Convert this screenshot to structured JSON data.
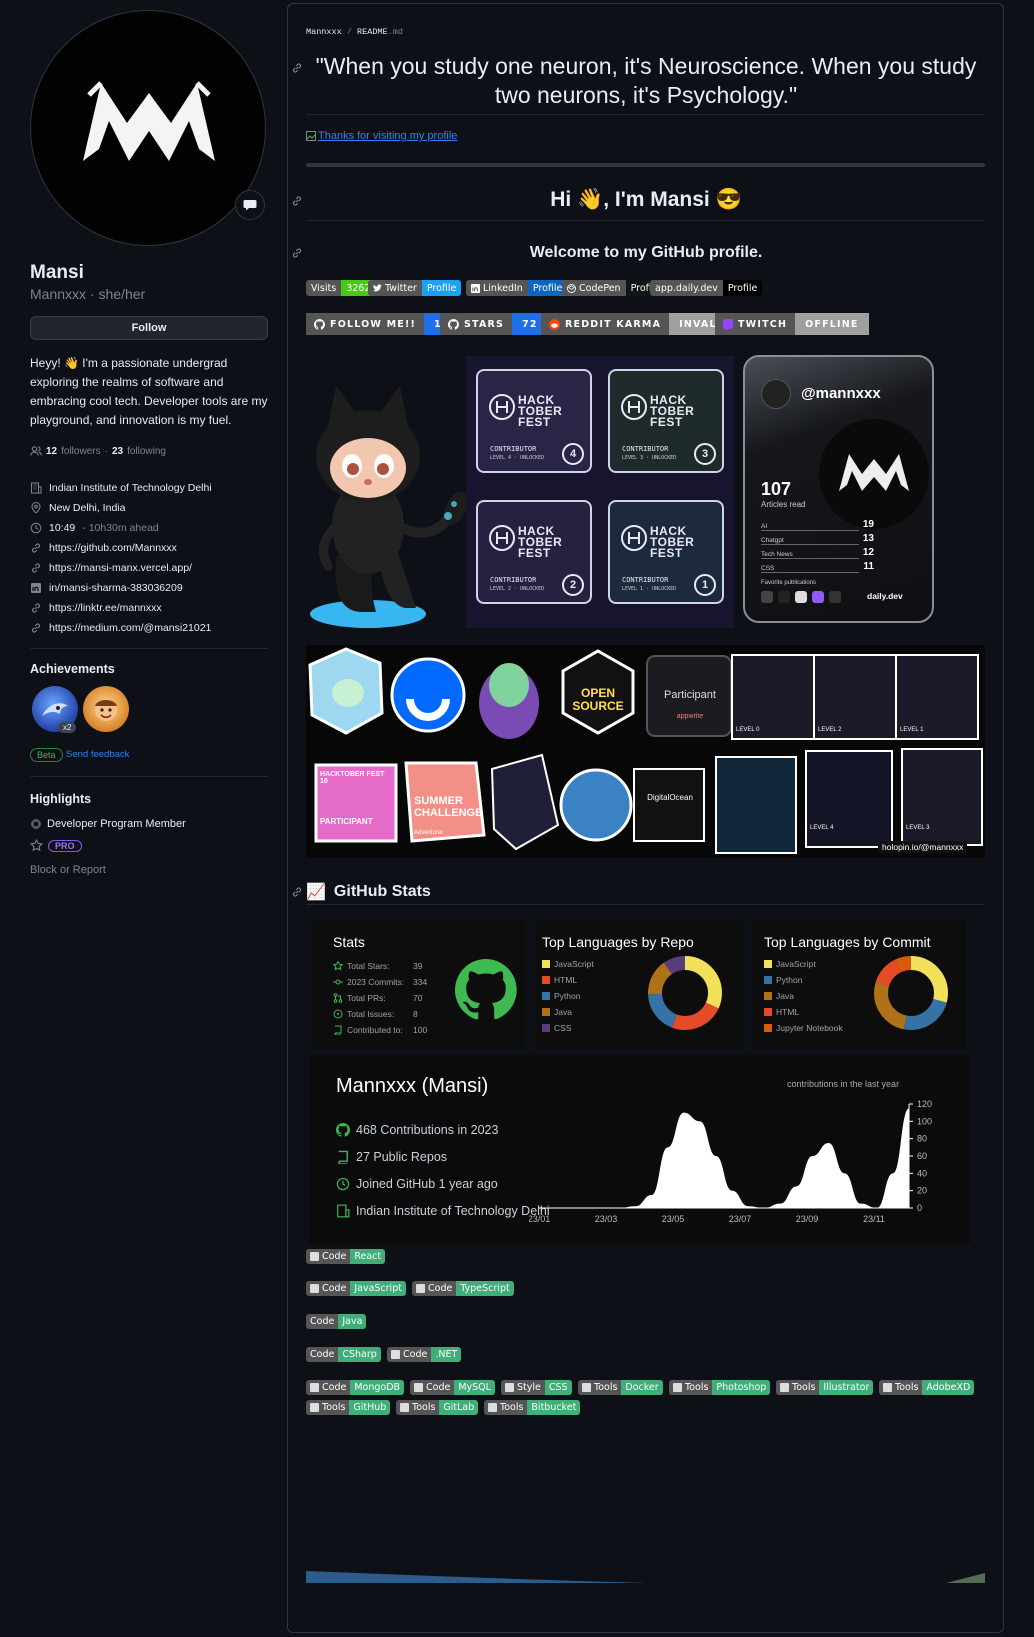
{
  "profile": {
    "name": "Mansi",
    "login": "Mannxxx",
    "pronouns": "she/her",
    "separator": "·",
    "follow_label": "Follow",
    "bio": "Heyy! 👋 I'm a passionate undergrad exploring the realms of software and embracing cool tech. Developer tools are my playground, and innovation is my fuel.",
    "followers_count": "12",
    "followers_label": "followers",
    "following_count": "23",
    "following_label": "following",
    "organization": "Indian Institute of Technology Delhi",
    "location": "New Delhi, India",
    "local_time": "10:49",
    "time_ahead": "- 10h30m ahead",
    "links": [
      "https://github.com/Mannxxx",
      "https://mansi-manx.vercel.app/",
      "in/mansi-sharma-383036209",
      "https://linktr.ee/mannxxx",
      "https://medium.com/@mansi21021"
    ]
  },
  "achievements": {
    "title": "Achievements",
    "multiplier": "x2",
    "beta_label": "Beta",
    "feedback_label": "Send feedback"
  },
  "highlights": {
    "title": "Highlights",
    "program": "Developer Program Member",
    "pro_label": "PRO",
    "block_report": "Block or Report"
  },
  "readme": {
    "breadcrumb_user": "Mannxxx",
    "breadcrumb_sep": " / ",
    "breadcrumb_file": "README",
    "breadcrumb_ext": ".md",
    "quote": "\"When you study one neuron, it's Neuroscience. When you study two neurons, it's Psychology.\"",
    "thanks_link": "Thanks for visiting my profile",
    "greeting": "Hi 👋, I'm Mansi 😎",
    "welcome": "Welcome to my GitHub profile.",
    "stats_heading": "GitHub Stats",
    "stats_emoji": "📈"
  },
  "shields": [
    {
      "label": "Visits",
      "value": "3262",
      "color": "#4c1"
    },
    {
      "label": "Twitter",
      "value": "Profile",
      "color": "#1ca0f1"
    },
    {
      "label": "LinkedIn",
      "value": "Profile",
      "color": "#0a66c2"
    },
    {
      "label": "CodePen",
      "value": "Profile",
      "color": "#131417"
    },
    {
      "label": "app.daily.dev",
      "value": "Profile",
      "color": "#000000"
    }
  ],
  "for_the_badge": [
    {
      "label": "FOLLOW ME!!",
      "value": "12",
      "color": "#1f6feb"
    },
    {
      "label": "STARS",
      "value": "72",
      "color": "#1f6feb"
    },
    {
      "label": "REDDIT KARMA",
      "value": "INVALID",
      "color": "#9f9f9f"
    },
    {
      "label": "TWITCH",
      "value": "OFFLINE",
      "color": "#9f9f9f"
    }
  ],
  "hacktoberfest": {
    "title": "HACK TOBER FEST",
    "levels": [
      {
        "label": "CONTRIBUTOR",
        "level": "LEVEL 4 · UNLOCKED",
        "num": "4"
      },
      {
        "label": "CONTRIBUTOR",
        "level": "LEVEL 3 · UNLOCKED",
        "num": "3"
      },
      {
        "label": "CONTRIBUTOR",
        "level": "LEVEL 2 · UNLOCKED",
        "num": "2"
      },
      {
        "label": "CONTRIBUTOR",
        "level": "LEVEL 1 · UNLOCKED",
        "num": "1"
      }
    ]
  },
  "daily_dev": {
    "handle": "@mannxxx",
    "articles": "107",
    "articles_label": "Articles read",
    "tags": [
      {
        "name": "AI",
        "count": "19"
      },
      {
        "name": "Chatgpt",
        "count": "13"
      },
      {
        "name": "Tech News",
        "count": "12"
      },
      {
        "name": "CSS",
        "count": "11"
      }
    ],
    "favorite_label": "Favorite publications",
    "brand": "daily.dev"
  },
  "holopin": {
    "credit": "holopin.io/@mannxxx",
    "texts": {
      "open_source": "OPEN SOURCE",
      "participant": "Participant",
      "appwrite": "appwrite",
      "summer": "SUMMER CHALLENGE",
      "adventurer": "Adventurer",
      "digitalocean": "DigitalOcean",
      "hacktoberfest10": "HACKTOBER FEST 10",
      "participant_caps": "PARTICIPANT",
      "level0": "LEVEL 0",
      "level1": "LEVEL 1",
      "level2": "LEVEL 2",
      "level3": "LEVEL 3",
      "level4": "LEVEL 4"
    }
  },
  "stats_card": {
    "title": "Stats",
    "rows": [
      {
        "label": "Total Stars:",
        "value": "39"
      },
      {
        "label": "2023 Commits:",
        "value": "334"
      },
      {
        "label": "Total PRs:",
        "value": "70"
      },
      {
        "label": "Total Issues:",
        "value": "8"
      },
      {
        "label": "Contributed to:",
        "value": "100"
      }
    ]
  },
  "top_langs_repo": {
    "title": "Top Languages by Repo",
    "items": [
      {
        "name": "JavaScript",
        "color": "#f1e05a"
      },
      {
        "name": "HTML",
        "color": "#e34c26"
      },
      {
        "name": "Python",
        "color": "#3572A5"
      },
      {
        "name": "Java",
        "color": "#b07219"
      },
      {
        "name": "CSS",
        "color": "#563d7c"
      }
    ]
  },
  "top_langs_commit": {
    "title": "Top Languages by Commit",
    "items": [
      {
        "name": "JavaScript",
        "color": "#f1e05a"
      },
      {
        "name": "Python",
        "color": "#3572A5"
      },
      {
        "name": "Java",
        "color": "#b07219"
      },
      {
        "name": "HTML",
        "color": "#e34c26"
      },
      {
        "name": "Jupyter Notebook",
        "color": "#DA5B0B"
      }
    ]
  },
  "activity": {
    "title": "Mannxxx (Mansi)",
    "contributions": "468 Contributions in 2023",
    "repos": "27 Public Repos",
    "joined": "Joined GitHub 1 year ago",
    "org": "Indian Institute of Technology Delhi"
  },
  "chart_data": {
    "type": "area",
    "title": "contributions in the last year",
    "xlabel": "",
    "ylabel": "",
    "x_ticks": [
      "23/01",
      "23/03",
      "23/05",
      "23/07",
      "23/09",
      "23/11"
    ],
    "y_ticks": [
      "0",
      "20",
      "40",
      "60",
      "80",
      "100",
      "120"
    ],
    "ylim": [
      0,
      120
    ],
    "x": [
      0,
      1,
      2,
      3,
      4,
      5,
      6,
      7,
      8,
      9,
      10,
      11,
      12,
      13,
      14,
      15,
      16,
      17,
      18,
      19,
      20,
      21,
      22,
      23
    ],
    "values": [
      0,
      0,
      0,
      0,
      0,
      0,
      2,
      15,
      70,
      110,
      100,
      60,
      20,
      2,
      0,
      5,
      25,
      60,
      75,
      40,
      5,
      0,
      40,
      115
    ],
    "grid": false
  },
  "tech_badges": [
    [
      {
        "label": "Code",
        "value": "React",
        "icon": "react-icon"
      }
    ],
    [
      {
        "label": "Code",
        "value": "JavaScript",
        "icon": "javascript-icon"
      },
      {
        "label": "Code",
        "value": "TypeScript",
        "icon": "typescript-icon"
      }
    ],
    [
      {
        "label": "Code",
        "value": "Java",
        "icon": ""
      }
    ],
    [
      {
        "label": "Code",
        "value": "CSharp",
        "icon": ""
      },
      {
        "label": "Code",
        "value": ".NET",
        "icon": "dotnet-icon"
      }
    ],
    [
      {
        "label": "Code",
        "value": "MongoDB",
        "icon": "mongodb-icon"
      },
      {
        "label": "Code",
        "value": "MySQL",
        "icon": "mysql-icon"
      },
      {
        "label": "Style",
        "value": "CSS",
        "icon": "css-icon"
      },
      {
        "label": "Tools",
        "value": "Docker",
        "icon": "docker-icon"
      },
      {
        "label": "Tools",
        "value": "Photoshop",
        "icon": "photoshop-icon"
      },
      {
        "label": "Tools",
        "value": "Illustrator",
        "icon": "illustrator-icon"
      },
      {
        "label": "Tools",
        "value": "AdobeXD",
        "icon": "adobexd-icon"
      }
    ],
    [
      {
        "label": "Tools",
        "value": "GitHub",
        "icon": "github-icon"
      },
      {
        "label": "Tools",
        "value": "GitLab",
        "icon": "gitlab-icon"
      },
      {
        "label": "Tools",
        "value": "Bitbucket",
        "icon": "bitbucket-icon"
      }
    ]
  ],
  "colors": {
    "bg": "#0d1117",
    "border": "#30363d",
    "link": "#2f81f7",
    "badge_green": "#3fae78"
  }
}
